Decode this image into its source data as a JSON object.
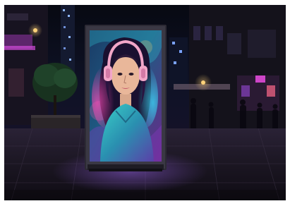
{
  "scene": {
    "subject": "billboard-lightbox",
    "palette": {
      "sky": "#0a0c1c",
      "plaza": "#1c1826",
      "neon_magenta": "#c23ad1",
      "neon_cyan": "#2bd3f0",
      "hair": "#1a1030",
      "headphones": "#f2a6c8",
      "skin": "#e9b79a",
      "jacket": "#2a8fb0",
      "lamp_glow": "#f7c46a"
    },
    "icons": [
      "headphones-icon"
    ]
  }
}
